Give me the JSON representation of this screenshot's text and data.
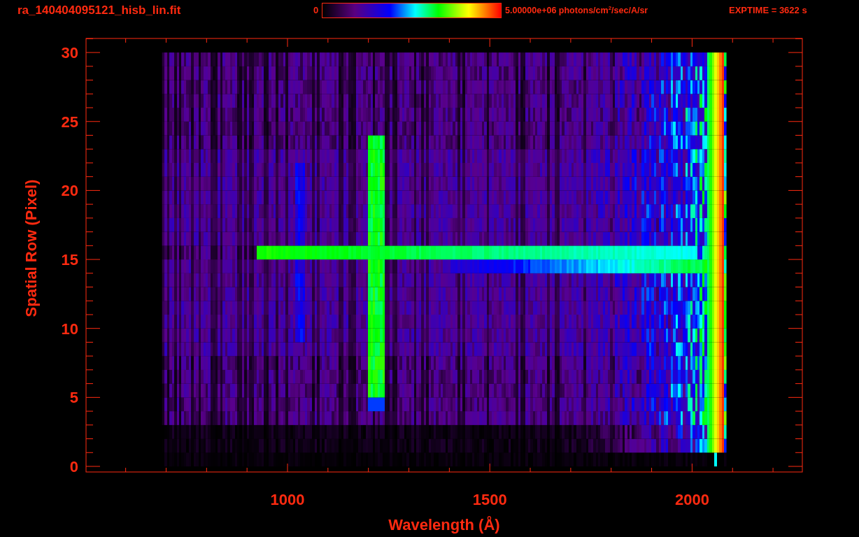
{
  "title": "ra_140404095121_hisb_lin.fit",
  "colorbar": {
    "min_label": "0",
    "max_label": "5.00000e+06 photons/cm$^{2}$/sec/A/sr"
  },
  "exposure": "EXPTIME = 3622 s",
  "plot": {
    "xlabel": "Wavelength (Å)",
    "ylabel": "Spatial Row (Pixel)",
    "xticks": [
      "1000",
      "1500",
      "2000"
    ],
    "yticks": [
      "30",
      "25",
      "20",
      "15",
      "10",
      "5",
      "0"
    ]
  }
}
